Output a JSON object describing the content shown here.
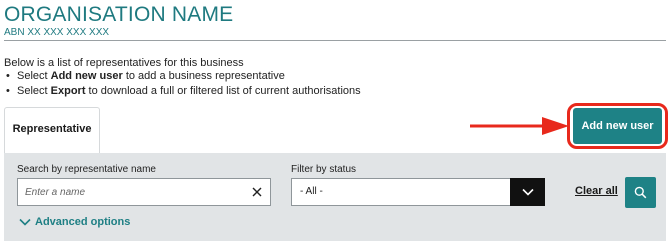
{
  "header": {
    "org_name": "ORGANISATION NAME",
    "abn": "ABN XX XXX XXX XXX"
  },
  "intro": {
    "text": "Below is a list of representatives for this business",
    "bullets": [
      {
        "prefix": "Select ",
        "bold": "Add new user",
        "suffix": " to add a business representative"
      },
      {
        "prefix": "Select ",
        "bold": "Export",
        "suffix": " to download a full or filtered list of current authorisations"
      }
    ]
  },
  "tabs": [
    {
      "label": "Representative",
      "active": true
    }
  ],
  "actions": {
    "add_new_user_label": "Add new user"
  },
  "filters": {
    "search": {
      "label": "Search by representative name",
      "placeholder": "Enter a name",
      "value": ""
    },
    "status": {
      "label": "Filter by status",
      "selected": "- All -"
    },
    "clear_all_label": "Clear all",
    "advanced_options_label": "Advanced options"
  },
  "icons": {
    "clear_search": "close-icon",
    "status_dropdown": "chevron-down-icon",
    "search_button": "search-icon",
    "advanced_toggle": "chevron-down-icon",
    "callout_arrow": "arrow-right-icon"
  },
  "colors": {
    "brand_teal": "#1e8286",
    "heading_teal": "#1f7a80",
    "highlight_red": "#e8291c",
    "panel_gray": "#e1e4e6"
  }
}
